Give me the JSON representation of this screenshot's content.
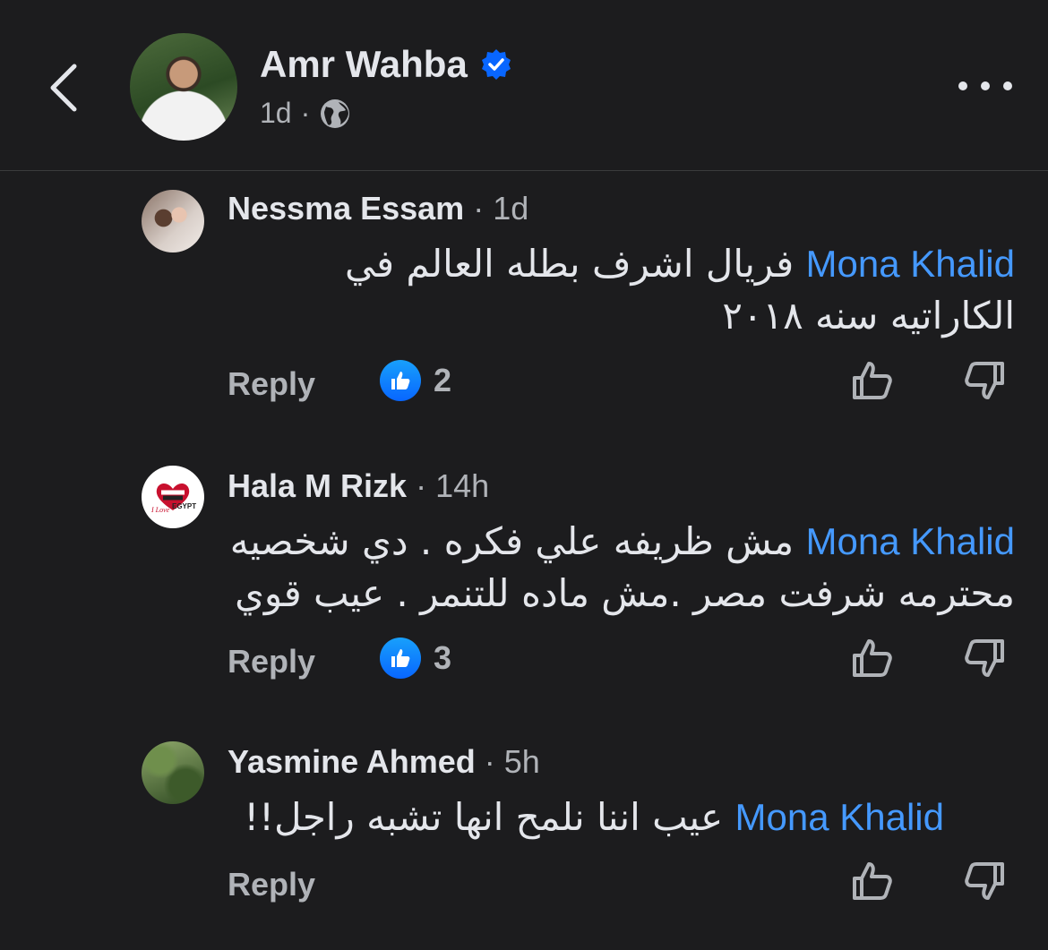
{
  "header": {
    "author": "Amr Wahba",
    "time": "1d",
    "separator": "·"
  },
  "comments": [
    {
      "name": "Nessma Essam",
      "time": "1d",
      "mention": "Mona Khalid",
      "text": "فريال اشرف بطله العالم في الكاراتيه سنه ٢٠١٨",
      "reply_label": "Reply",
      "likes": "2"
    },
    {
      "name": "Hala M Rizk",
      "time": "14h",
      "mention": "Mona Khalid",
      "text": "مش ظريفه علي فكره . دي شخصيه محترمه شرفت مصر .مش ماده للتنمر .  عيب قوي",
      "reply_label": "Reply",
      "likes": "3",
      "avatar_text_1": "I Love",
      "avatar_text_2": "EGYPT"
    },
    {
      "name": "Yasmine Ahmed",
      "time": "5h",
      "mention": "Mona Khalid",
      "text": "عيب اننا نلمح انها تشبه راجل!!",
      "reply_label": "Reply"
    }
  ],
  "colors": {
    "background": "#1c1c1e",
    "mention": "#4599ff",
    "like_badge": "#0866ff",
    "verified": "#0866ff"
  },
  "icons": [
    "back-chevron-icon",
    "verified-badge-icon",
    "globe-icon",
    "more-icon",
    "like-badge-icon",
    "thumbs-up-icon",
    "thumbs-down-icon"
  ]
}
